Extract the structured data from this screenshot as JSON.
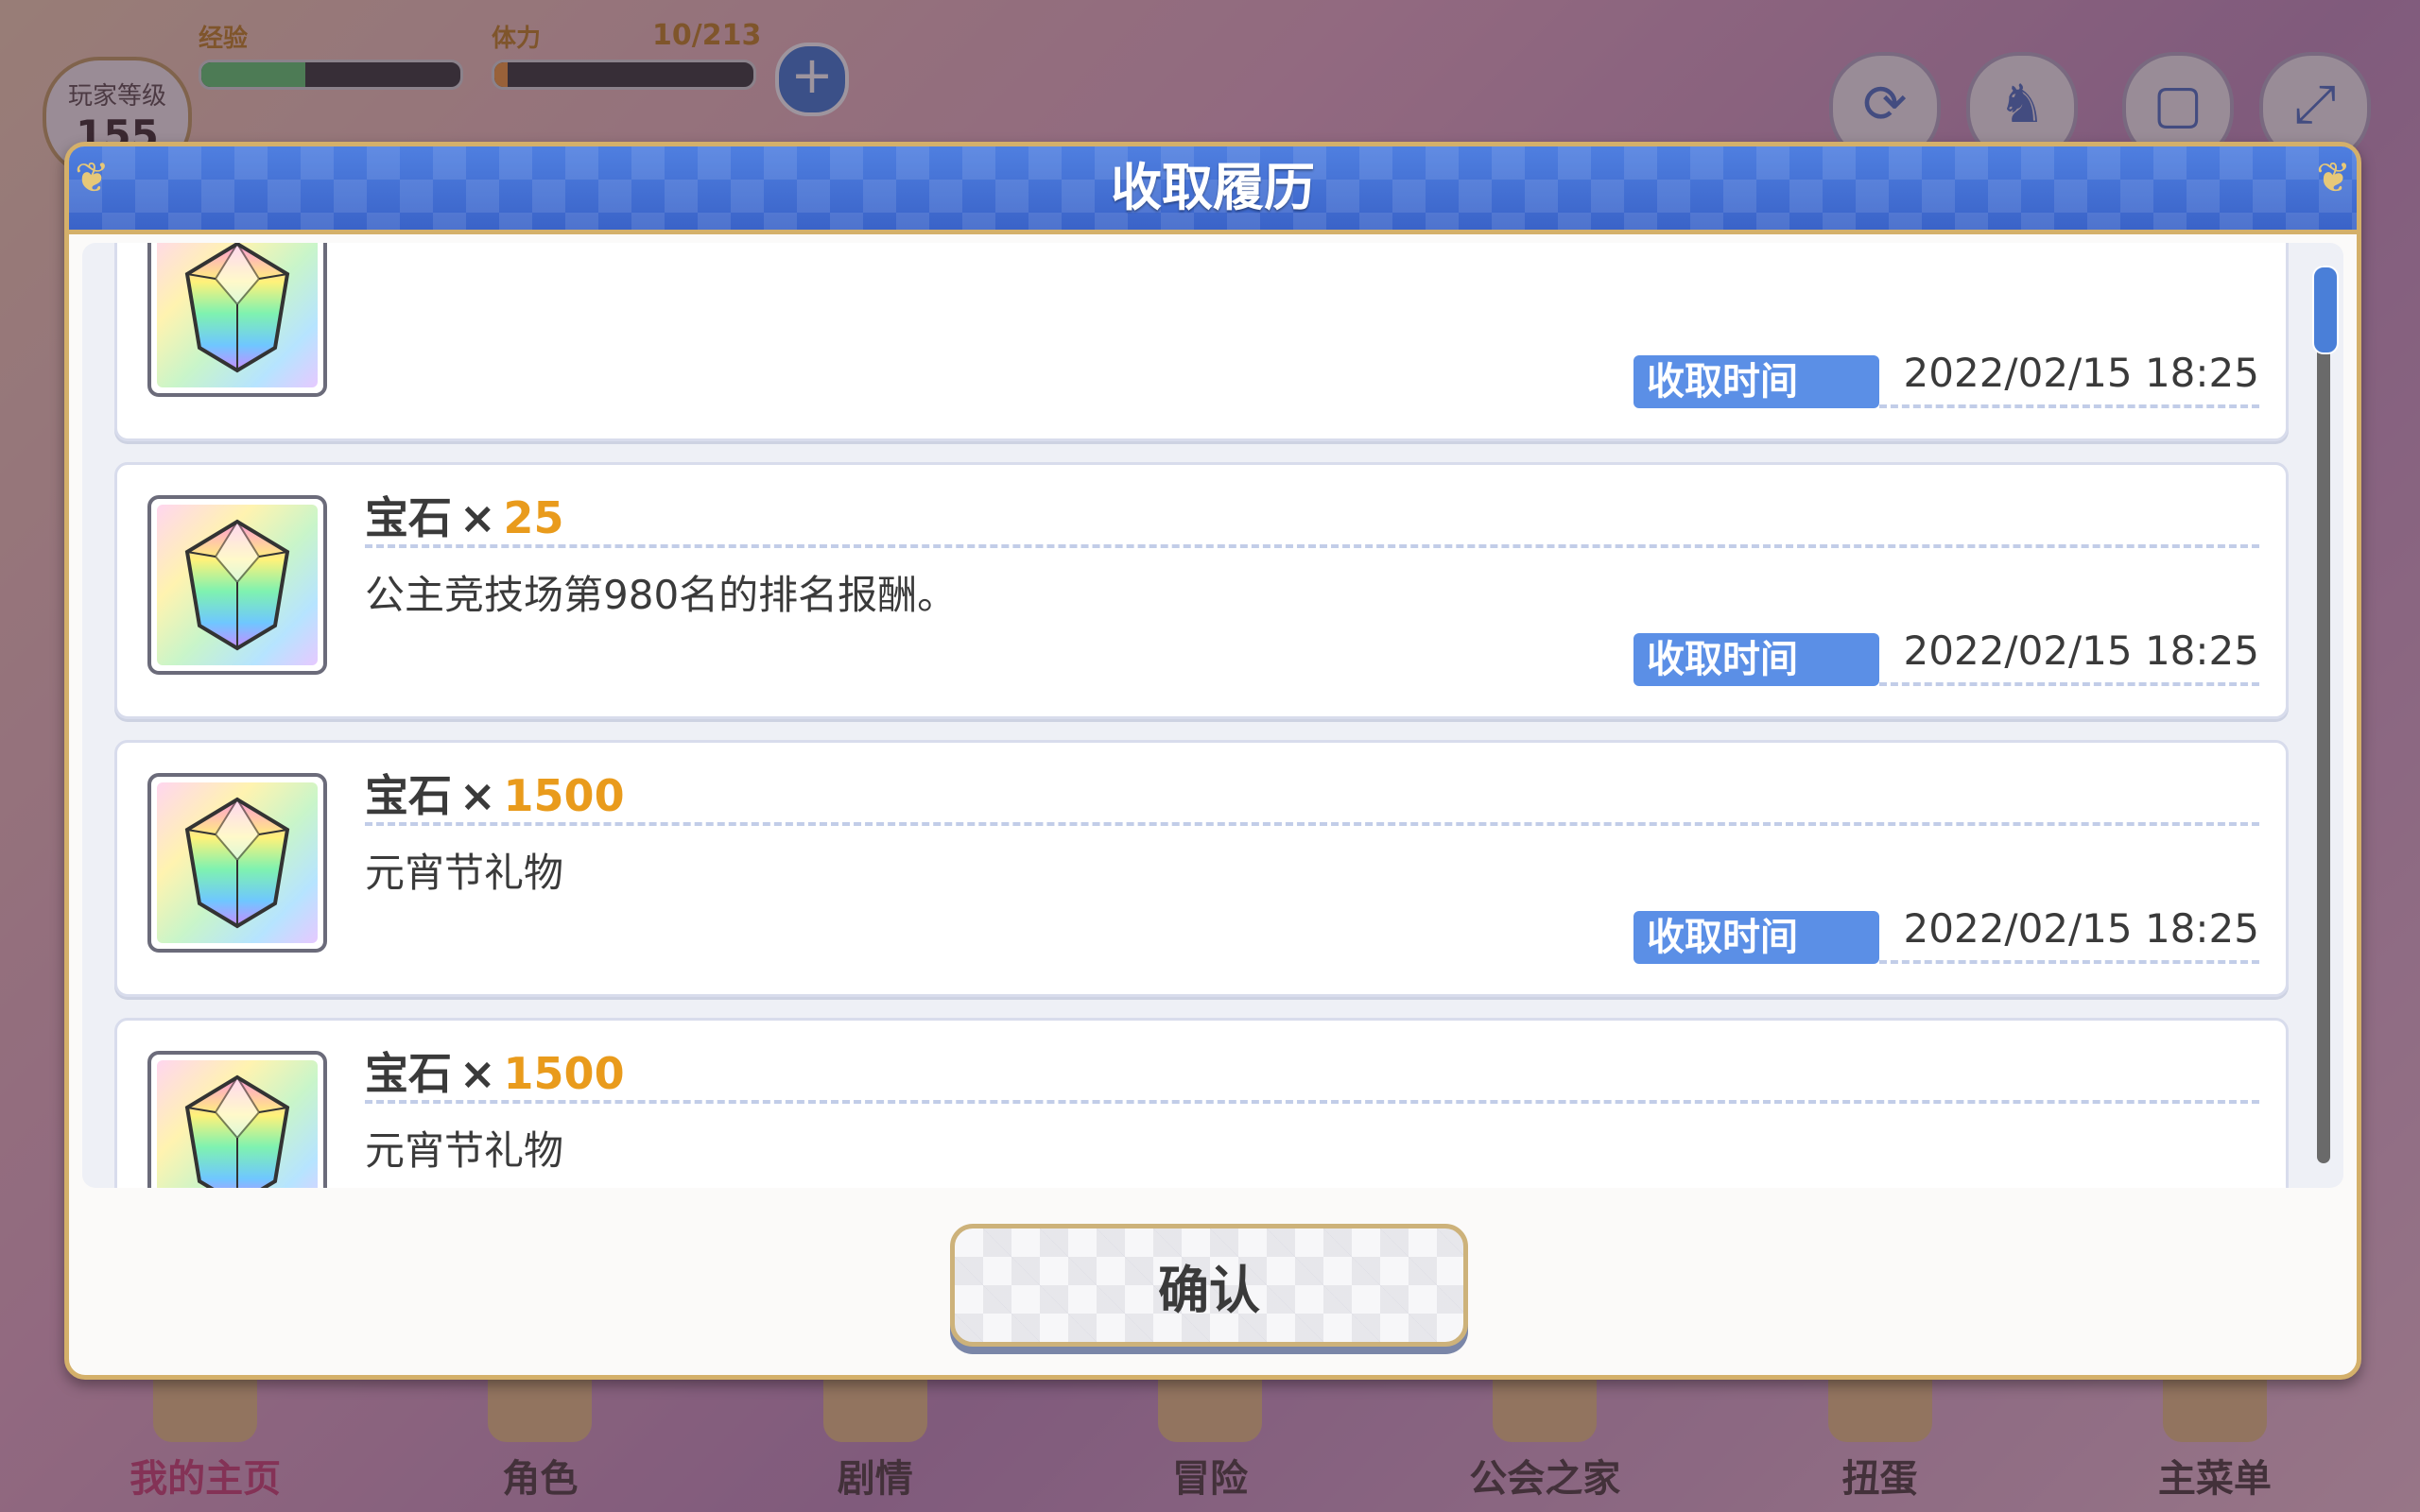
{
  "background": {
    "player_level_label": "玩家等级",
    "player_level_value": "155",
    "exp_label": "经验",
    "stamina_label": "体力",
    "stamina_value": "10/213",
    "exp_progress": 0.4,
    "stamina_progress": 0.05,
    "top_buttons": [
      "refresh-icon",
      "character-icon",
      "window-icon",
      "fullscreen-icon"
    ],
    "nav": [
      {
        "label": "我的主页",
        "active": true
      },
      {
        "label": "角色"
      },
      {
        "label": "剧情"
      },
      {
        "label": "冒险"
      },
      {
        "label": "公会之家"
      },
      {
        "label": "扭蛋"
      },
      {
        "label": "主菜单"
      }
    ]
  },
  "dialog": {
    "title": "收取履历",
    "confirm_label": "确认",
    "time_label": "收取时间",
    "items": [
      {
        "name": "",
        "x": "",
        "qty": "",
        "desc": "",
        "time": "2022/02/15  18:25"
      },
      {
        "name": "宝石",
        "x": "×",
        "qty": "25",
        "desc": "公主竞技场第980名的排名报酬。",
        "time": "2022/02/15  18:25"
      },
      {
        "name": "宝石",
        "x": "×",
        "qty": "1500",
        "desc": "元宵节礼物",
        "time": "2022/02/15  18:25"
      },
      {
        "name": "宝石",
        "x": "×",
        "qty": "1500",
        "desc": "元宵节礼物",
        "time": "2022/02/15  18:25"
      },
      {
        "name": "",
        "x": "",
        "qty": "",
        "desc": "",
        "time": ""
      }
    ]
  }
}
